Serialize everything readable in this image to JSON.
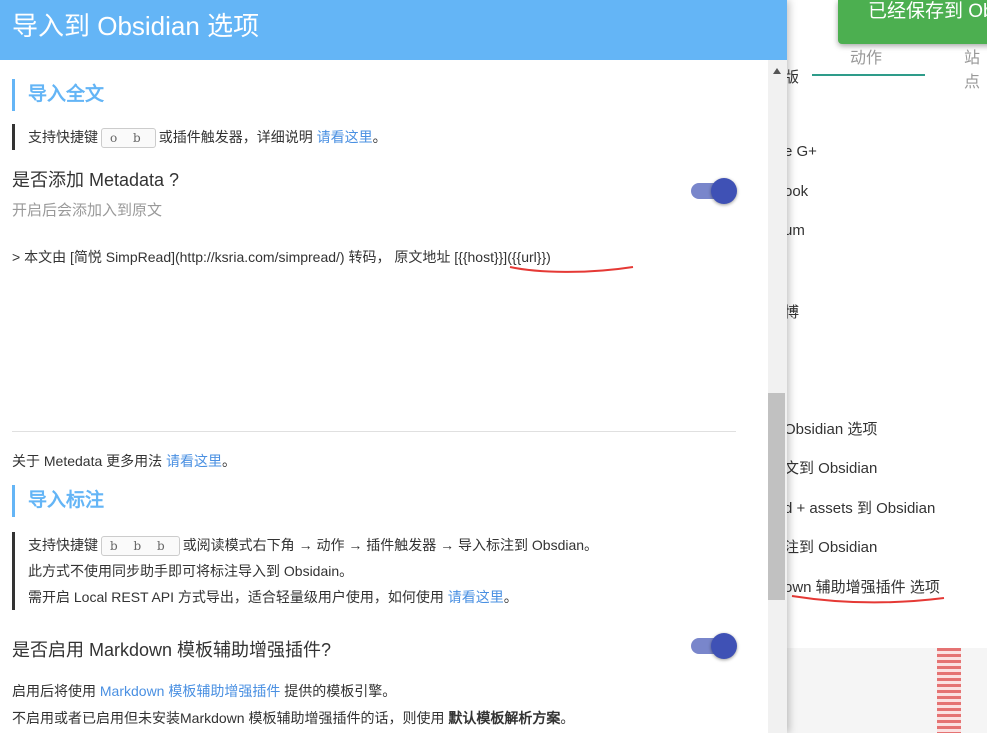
{
  "background": {
    "tabs": [
      "动作",
      "站点"
    ],
    "toast": "已经保存到 Ob",
    "items": [
      "版",
      "e G+",
      "ook",
      "um",
      "博",
      "Obsidian 选项",
      "文到 Obsidian",
      "d + assets 到 Obsidian",
      "注到 Obsidian",
      "own 辅助增强插件 选项"
    ]
  },
  "dialog": {
    "title": "导入到 Obsidian 选项",
    "section1": {
      "title": "导入全文",
      "hint_prefix": "支持快捷键",
      "hint_key": "o b",
      "hint_middle": "或插件触发器，详细说明",
      "hint_link": "请看这里",
      "hint_suffix": "。"
    },
    "metadata": {
      "label": "是否添加 Metadata ?",
      "desc": "开启后会添加入到原文",
      "enabled": true,
      "template": "> 本文由 [简悦 SimpRead](http://ksria.com/simpread/) 转码， 原文地址 [{{host}}]({{url}})"
    },
    "metadata_more": {
      "prefix": "关于 Metedata 更多用法",
      "link": "请看这里",
      "suffix": "。"
    },
    "section2": {
      "title": "导入标注",
      "line1_prefix": "支持快捷键",
      "line1_key": "b b b",
      "line1_suffix": "或阅读模式右下角 → 动作 → 插件触发器 → 导入标注到 Obsdian。",
      "line2": "此方式不使用同步助手即可将标注导入到 Obsidain。",
      "line3_prefix": "需开启 Local REST API 方式导出，适合轻量级用户使用，如何使用",
      "line3_link": "请看这里",
      "line3_suffix": "。"
    },
    "markdown": {
      "label": "是否启用 Markdown 模板辅助增强插件?",
      "enabled": true,
      "desc1_prefix": "启用后将使用",
      "desc1_link": "Markdown 模板辅助增强插件",
      "desc1_suffix": "提供的模板引擎。",
      "desc2_prefix": "不启用或者已启用但未安装Markdown 模板辅助增强插件的话，则使用",
      "desc2_bold": "默认模板解析方案",
      "desc2_suffix": "。"
    }
  },
  "colors": {
    "header": "#64b5f6",
    "accent": "#3f51b5",
    "link": "#4a90e2",
    "toast": "#4caf50",
    "annotation": "#e53935"
  }
}
